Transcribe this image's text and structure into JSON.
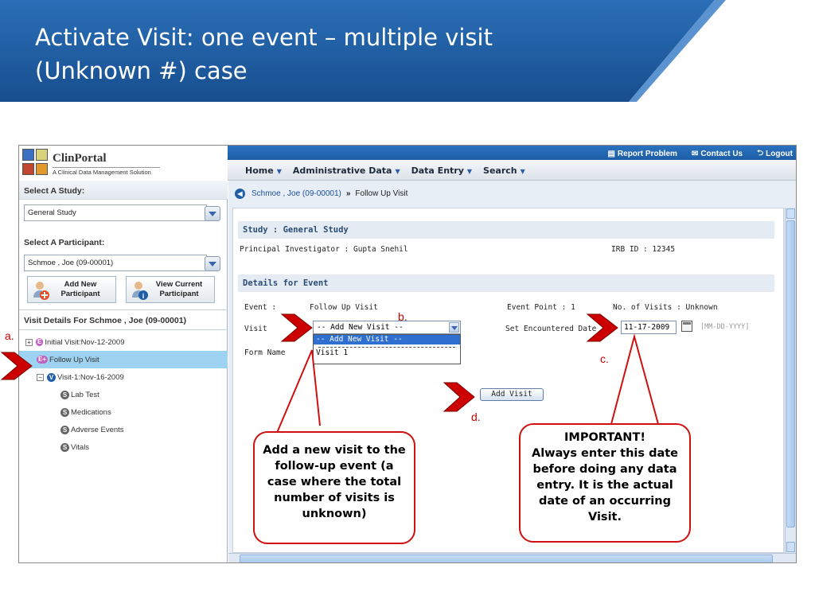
{
  "slide": {
    "title_line1": "Activate Visit: one event – multiple visit",
    "title_line2": "(Unknown #) case"
  },
  "app": {
    "logo_name": "ClinPortal",
    "logo_sub": "A Clinical Data Management Solution",
    "top_links": {
      "report": "Report Problem",
      "contact": "Contact Us",
      "logout": "Logout"
    },
    "nav": [
      {
        "label": "Home"
      },
      {
        "label": "Administrative Data"
      },
      {
        "label": "Data Entry"
      },
      {
        "label": "Search"
      }
    ],
    "sidebar": {
      "study_label": "Select A Study:",
      "study_value": "General Study",
      "participant_label": "Select A Participant:",
      "participant_value": "Schmoe , Joe (09-00001)",
      "add_btn": {
        "line1": "Add New",
        "line2": "Participant"
      },
      "view_btn": {
        "line1": "View Current",
        "line2": "Participant"
      },
      "visit_header": "Visit Details For  Schmoe , Joe (09-00001)",
      "tree": {
        "initial": "Initial Visit:Nov-12-2009",
        "followup": "Follow Up Visit",
        "visit1": "Visit-1:Nov-16-2009",
        "forms": [
          "Lab Test",
          "Medications",
          "Adverse Events",
          "Vitals"
        ]
      }
    },
    "breadcrumb": {
      "participant": "Schmoe , Joe (09-00001)",
      "sep": "»",
      "current": "Follow Up Visit"
    },
    "study_section": {
      "head": "Study : General Study",
      "pi": "Principal Investigator : Gupta Snehil",
      "irb": "IRB ID : 12345"
    },
    "event_section": {
      "head": "Details for Event",
      "event_label": "Event :",
      "event_value": "Follow Up Visit",
      "event_point": "Event Point : 1",
      "num_visits": "No. of Visits : Unknown",
      "visit_label": "Visit",
      "visit_selected": "-- Add New Visit --",
      "visit_options": [
        "-- Add New Visit --",
        "Visit 1"
      ],
      "encounter_label": "Set Encountered Date",
      "encounter_value": "11-17-2009",
      "date_format": "[MM-DD-YYYY]",
      "form_label": "Form Name",
      "add_visit_btn": "Add Visit"
    }
  },
  "annotations": {
    "a": "a.",
    "b": "b.",
    "c": "c.",
    "d": "d.",
    "callout_left": "Add a new visit to the follow-up event (a case where the total number of visits is unknown)",
    "callout_right_1": "IMPORTANT!",
    "callout_right_2": "Always enter this date before doing any data entry. It is the actual date of an occurring Visit."
  },
  "colors": {
    "banner": "#1f5fa8",
    "accent_red": "#cc0000",
    "selected_row": "#9dd2f0"
  }
}
